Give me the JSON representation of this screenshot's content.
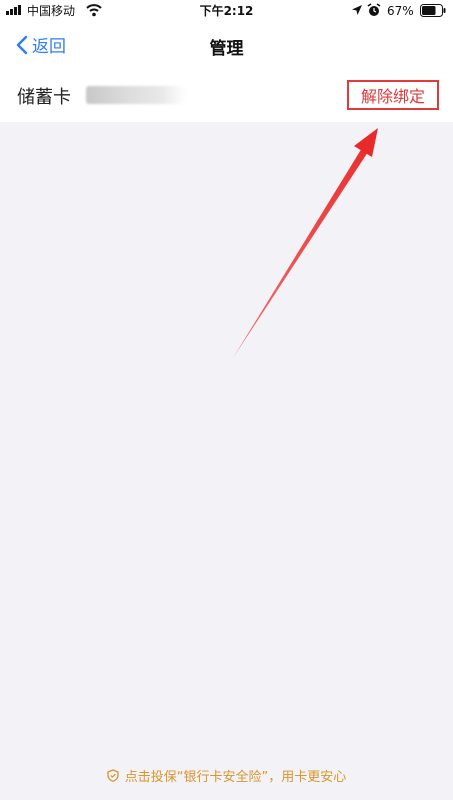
{
  "status_bar": {
    "carrier": "中国移动",
    "time": "下午2:12",
    "battery": "67%"
  },
  "nav": {
    "back_label": "返回",
    "title": "管理"
  },
  "card": {
    "label": "储蓄卡",
    "action_label": "解除绑定"
  },
  "footer": {
    "note": "点击投保“银行卡安全险”，用卡更安心"
  },
  "icons": [
    "signal-icon",
    "wifi-icon",
    "location-icon",
    "alarm-icon",
    "battery-icon",
    "back-chevron-icon",
    "shield-icon"
  ],
  "colors": {
    "accent_blue": "#2f7cf6",
    "danger_red": "#e0383a",
    "footer_orange": "#d9962c",
    "background": "#f3f2f7"
  }
}
